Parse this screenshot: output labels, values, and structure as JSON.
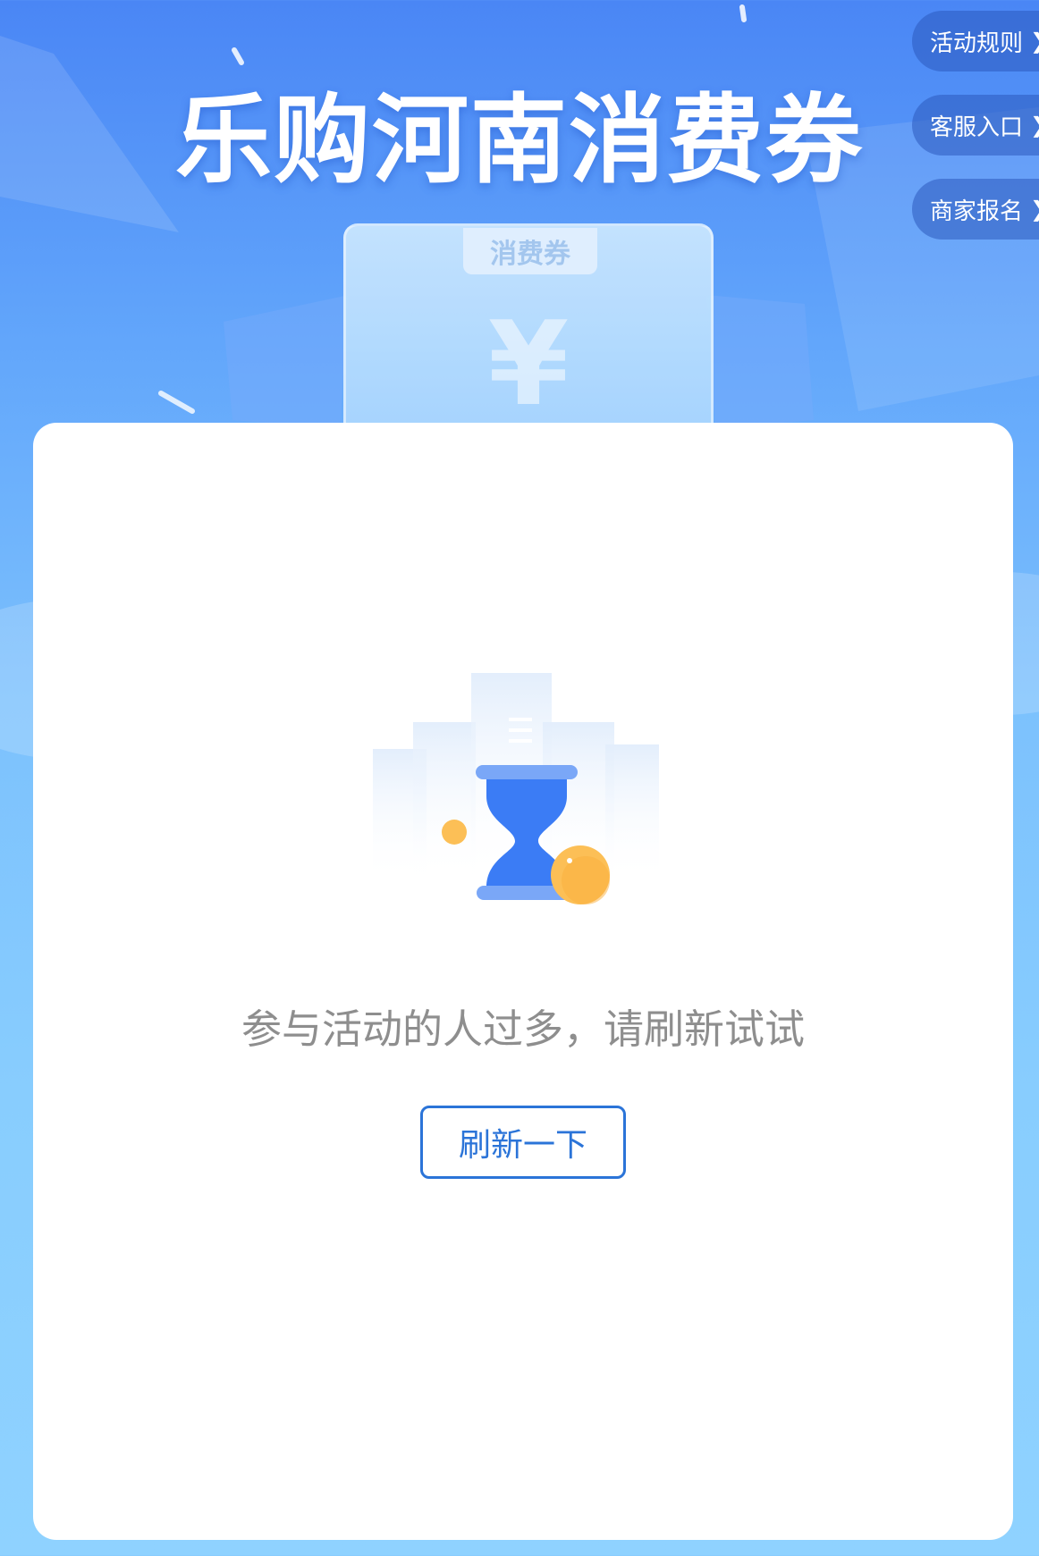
{
  "header": {
    "title": "乐购河南消费券"
  },
  "side_links": [
    {
      "label": "活动规则",
      "icon": "chevron-right-icon"
    },
    {
      "label": "客服入口",
      "icon": "chevron-right-icon"
    },
    {
      "label": "商家报名",
      "icon": "chevron-right-icon"
    }
  ],
  "voucher": {
    "tag": "消费券",
    "symbol": "¥"
  },
  "card": {
    "illustration": "hourglass-icon",
    "message": "参与活动的人过多，请刷新试试",
    "refresh_label": "刷新一下"
  },
  "colors": {
    "accent": "#2b74d8",
    "coin": "#fcbf56",
    "hourglass": "#3b7cf5"
  }
}
